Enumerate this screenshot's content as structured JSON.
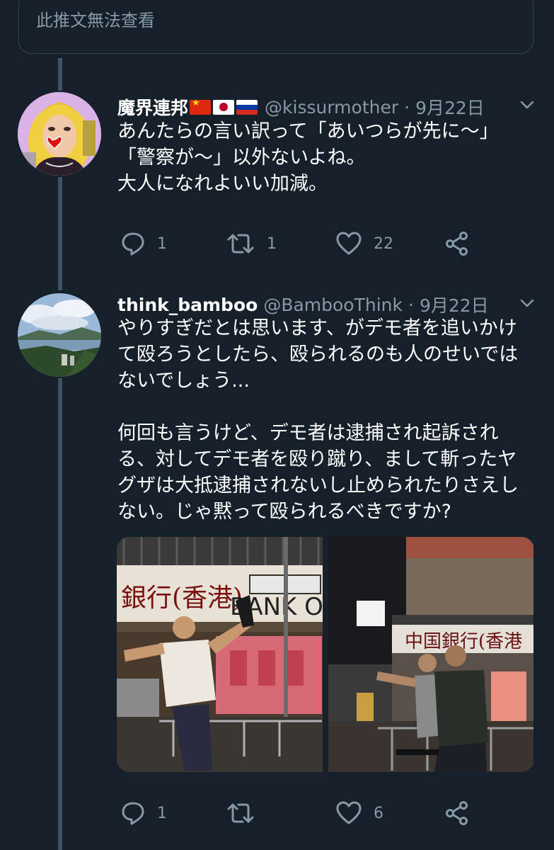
{
  "unavailable_notice": "此推文無法查看",
  "tweets": [
    {
      "name": "魔界連邦",
      "handle": "@kissurmother",
      "date": "9月22日",
      "text": "あんたらの言い訳って「あいつらが先に〜」\n「警察が〜」以外ないよね。\n大人になれよいい加減。",
      "replies": "1",
      "retweets": "1",
      "likes": "22",
      "flags": [
        "flag-china",
        "flag-japan",
        "flag-russia"
      ]
    },
    {
      "name": "think_bamboo",
      "handle": "@BambooThink",
      "date": "9月22日",
      "text": "やりすぎだとは思います、がデモ者を追いかけ\nて殴ろうとしたら、殴られるのも人のせいでは\nないでしょう...\n\n何回も言うけど、デモ者は逮捕され起訴され\nる、対してデモ者を殴り蹴り、まして斬ったヤ\nグザは大抵逮捕されないし止められたりさえし\nない。じゃ黙って殴られるべきですか?",
      "replies": "1",
      "retweets": "",
      "likes": "6",
      "media": {
        "left": {
          "sign_text": "銀行(香港)",
          "sign_text_2": "BANK OF"
        },
        "right": {
          "sign_text": "中国銀行(香港"
        }
      }
    }
  ],
  "separator": "·",
  "colors": {
    "background": "#15202b",
    "secondary_text": "#8899a6",
    "thread_line": "#3d5466",
    "border": "#38444d"
  },
  "icons": [
    "reply-icon",
    "retweet-icon",
    "like-icon",
    "share-icon",
    "chevron-down-icon"
  ]
}
